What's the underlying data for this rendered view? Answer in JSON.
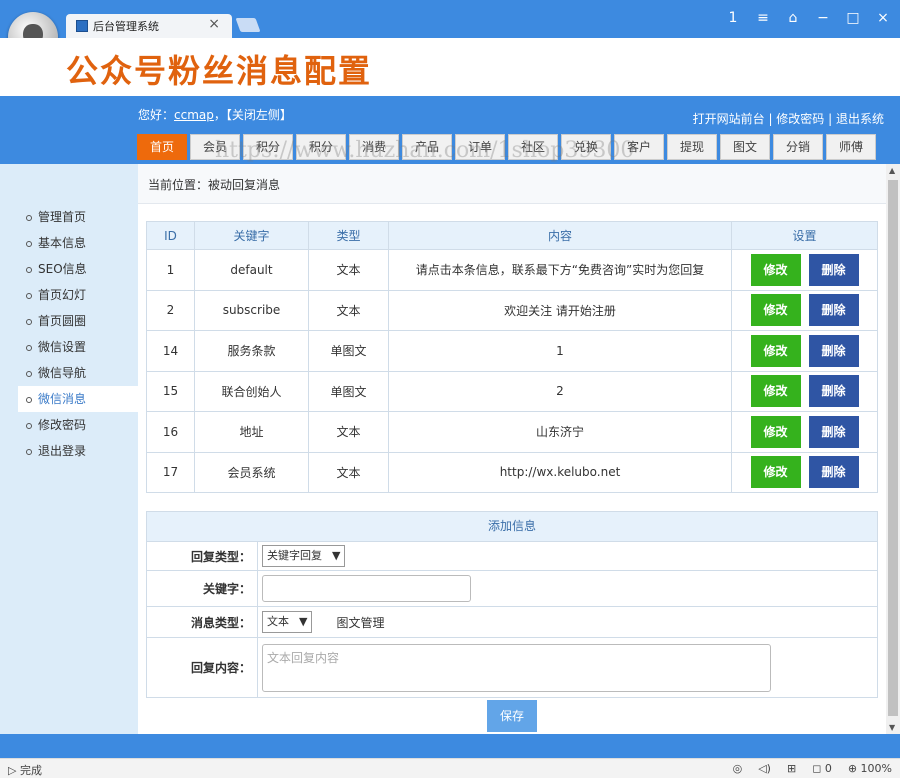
{
  "browser": {
    "tab_title": "后台管理系统",
    "tab_close": "×",
    "win_buttons": [
      "1",
      "≡",
      "⌂",
      "−",
      "□",
      "×"
    ]
  },
  "banner": {
    "title": "公众号粉丝消息配置"
  },
  "header": {
    "greeting_prefix": "您好：",
    "username": "ccmap",
    "close_left": "，【关闭左侧】",
    "links": {
      "front": "打开网站前台",
      "sep1": " | ",
      "change_pw": "修改密码",
      "sep2": " | ",
      "logout": "退出系统"
    }
  },
  "nav": [
    "首页",
    "会员",
    "积分",
    "积分",
    "消费",
    "产品",
    "订单",
    "社区",
    "兑换",
    "客户",
    "提现",
    "图文",
    "分销",
    "师傅"
  ],
  "watermark": "https://www.huzhan.com/1shop39300",
  "sidebar": {
    "items": [
      "管理首页",
      "基本信息",
      "SEO信息",
      "首页幻灯",
      "首页圆圈",
      "微信设置",
      "微信导航",
      "微信消息",
      "修改密码",
      "退出登录"
    ],
    "active_index": 7
  },
  "breadcrumb": "当前位置：被动回复消息",
  "table": {
    "headers": [
      "ID",
      "关键字",
      "类型",
      "内容",
      "设置"
    ],
    "rows": [
      {
        "id": "1",
        "keyword": "default",
        "type": "文本",
        "content": "请点击本条信息，联系最下方“免费咨询”实时为您回复"
      },
      {
        "id": "2",
        "keyword": "subscribe",
        "type": "文本",
        "content": "欢迎关注 请开始注册"
      },
      {
        "id": "14",
        "keyword": "服务条款",
        "type": "单图文",
        "content": "1"
      },
      {
        "id": "15",
        "keyword": "联合创始人",
        "type": "单图文",
        "content": "2"
      },
      {
        "id": "16",
        "keyword": "地址",
        "type": "文本",
        "content": "山东济宁"
      },
      {
        "id": "17",
        "keyword": "会员系统",
        "type": "文本",
        "content": "http://wx.kelubo.net"
      }
    ],
    "edit_label": "修改",
    "delete_label": "删除"
  },
  "form": {
    "title": "添加信息",
    "reply_type_label": "回复类型：",
    "reply_type_value": "关键字回复",
    "keyword_label": "关键字：",
    "msg_type_label": "消息类型：",
    "msg_type_value": "文本",
    "news_link": "图文管理",
    "content_label": "回复内容：",
    "content_placeholder": "文本回复内容",
    "save_label": "保存"
  },
  "status": {
    "left": "完成",
    "zoom": "100%",
    "badge": "0"
  }
}
